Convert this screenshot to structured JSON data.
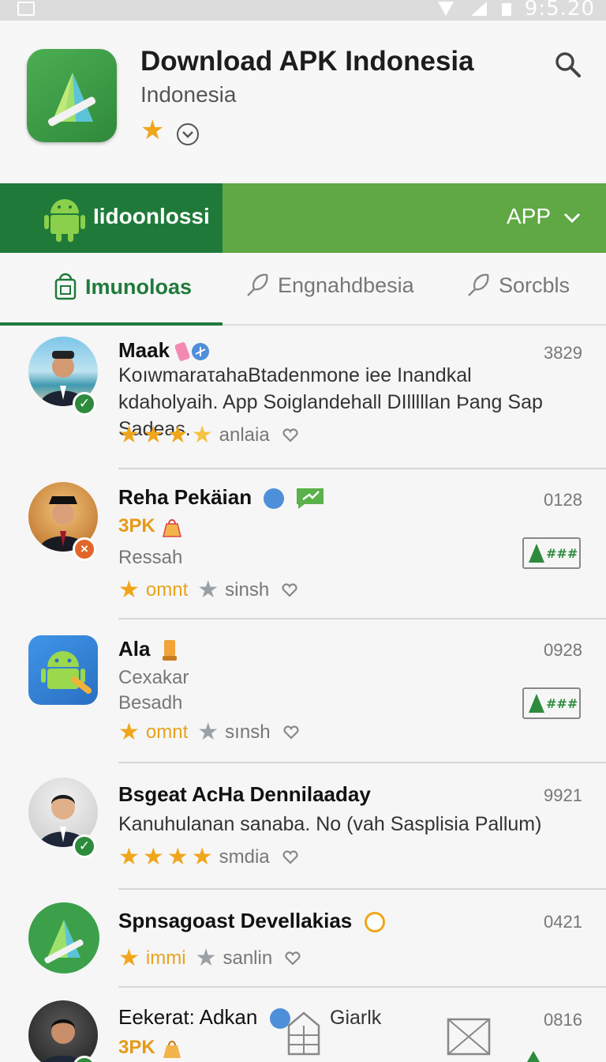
{
  "status_bar": {
    "time": "9:5.20"
  },
  "header": {
    "title": "Download APK Indonesia",
    "subtitle": "Indonesia"
  },
  "green_bar": {
    "left_label": "Iidoonlossi",
    "right_label": "APP"
  },
  "tabs": [
    {
      "label": "Imunoloas",
      "active": true
    },
    {
      "label": "Engnahdbesia",
      "active": false
    },
    {
      "label": "Sorcbls",
      "active": false
    }
  ],
  "items": [
    {
      "name": "Maak",
      "count": "3829",
      "desc": "KoıwmaraτahaBtadenmone iee Inandkal kdaholyaih. App Soiglandehall DIlllllan Þang Sap Sadeas.",
      "rating_text": "anlaia"
    },
    {
      "name": "Reha Pekäian",
      "count": "0128",
      "tag": "3PK",
      "line": "Ressah",
      "rating_text": "omnt",
      "rating_text2": "sinsh"
    },
    {
      "name": "Ala",
      "count": "0928",
      "line": "Cexakar",
      "line2": "Besadh",
      "rating_text": "omnt",
      "rating_text2": "sınsh"
    },
    {
      "name": "Bsgeat AcHa Dennilaaday",
      "count": "9921",
      "desc": "Kanuhulanan sanaba. No (vah Sasplisia Pallum)",
      "rating_text": "smdia"
    },
    {
      "name": "Spnsagoast Devellakias",
      "count": "0421",
      "rating_text": "immi",
      "rating_text2": "sanlin"
    },
    {
      "name": "Eekerat: Adkan",
      "count": "0816",
      "tag": "3PK",
      "extra": "Giarlk"
    }
  ],
  "colors": {
    "green_dark": "#1f7a3a",
    "green_light": "#5fa844",
    "star": "#f0a61c"
  }
}
